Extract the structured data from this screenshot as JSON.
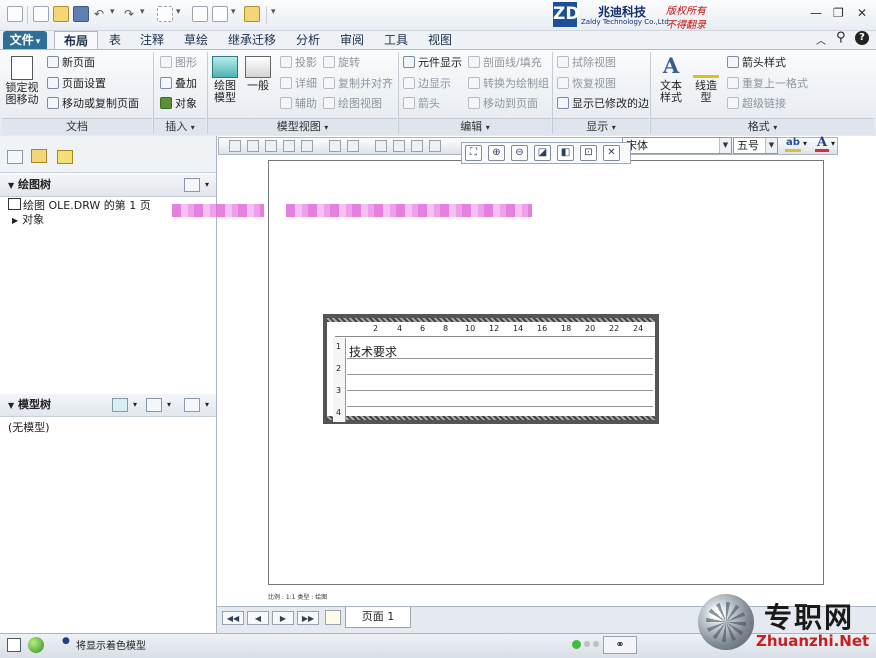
{
  "window": {
    "logo": {
      "mark": "ZD",
      "name_cn": "兆迪科技",
      "name_en": "Zaldy Technology Co.,Ltd.",
      "slogan1": "版权所有",
      "slogan2": "不得翻录"
    },
    "controls": {
      "minimize": "—",
      "restore": "❐",
      "close": "✕"
    }
  },
  "tabs": [
    {
      "label": "文件",
      "arrow": "▾"
    },
    {
      "label": "布局"
    },
    {
      "label": "表"
    },
    {
      "label": "注释"
    },
    {
      "label": "草绘"
    },
    {
      "label": "继承迁移"
    },
    {
      "label": "分析"
    },
    {
      "label": "审阅"
    },
    {
      "label": "工具"
    },
    {
      "label": "视图"
    }
  ],
  "ribbon": {
    "doc": {
      "group": "文档",
      "lock_view": "锁定视图移动",
      "new_page": "新页面",
      "page_setup": "页面设置",
      "move_copy": "移动或复制页面"
    },
    "insert": {
      "group": "插入",
      "graphics": "图形",
      "overlay": "叠加",
      "object": "对象"
    },
    "model_view": {
      "group": "模型视图",
      "drawing_model": "绘图模型",
      "general": "一般",
      "projection": "投影",
      "detail": "详细",
      "auxiliary": "辅助",
      "rotate": "旋转",
      "copy_align": "复制并对齐",
      "drawing_view": "绘图视图"
    },
    "edit": {
      "group": "编辑",
      "element_display": "元件显示",
      "edge_display": "边显示",
      "arrow": "箭头",
      "section_fill": "剖面线/填充",
      "convert_drawing": "转换为绘制组",
      "move_page": "移动到页面"
    },
    "display": {
      "group": "显示",
      "erase_view": "拭除视图",
      "restore_view": "恢复视图",
      "show_modified_edges": "显示已修改的边"
    },
    "format": {
      "group": "格式",
      "text_style": "文本样式",
      "line_style": "线造型",
      "arrow_style": "箭头样式",
      "repeat_format": "重复上一格式",
      "hyperlink": "超级链接"
    }
  },
  "font_bar": {
    "font": "宋体",
    "size": "五号"
  },
  "drawing_tree": {
    "title": "绘图树",
    "page_item": "绘图 OLE.DRW 的第 1 页",
    "object_item": "对象"
  },
  "model_tree": {
    "title": "模型树",
    "empty": "(无模型)"
  },
  "editor": {
    "text": "技术要求",
    "ruler": [
      "2",
      "4",
      "6",
      "8",
      "10",
      "12",
      "14",
      "16",
      "18",
      "20",
      "22",
      "24"
    ],
    "vruler": [
      "1",
      "2",
      "3",
      "4"
    ]
  },
  "sheet_footer": "比例 : 1:1  类型 : 绘图",
  "page_bar": {
    "page_label": "页面 1",
    "nav": [
      "◀◀",
      "◀",
      "▶",
      "▶▶"
    ]
  },
  "status": {
    "message": "将显示着色模型"
  },
  "watermark": {
    "cn": "专职网",
    "en": "Zhuanzhi.Net"
  }
}
